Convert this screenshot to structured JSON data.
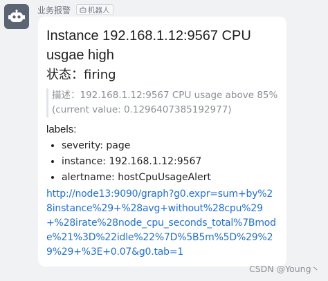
{
  "sender": {
    "name": "业务报警",
    "tag_icon": "robot-icon",
    "tag_label": "机器人",
    "avatar_icon": "robot-avatar-icon",
    "avatar_color": "#5a6472"
  },
  "message": {
    "title": "Instance 192.168.1.12:9567 CPU usgae high",
    "status_label": "状态：",
    "status_value": "firing",
    "description": "描述：192.168.1.12:9567 CPU usage above 85% (current value: 0.1296407385192977)",
    "labels_heading": "labels:",
    "labels": [
      "severity: page",
      "instance: 192.168.1.12:9567",
      "alertname: hostCpuUsageAlert"
    ],
    "link": "http://node13:9090/graph?g0.expr=sum+by%28instance%29+%28avg+without%28cpu%29+%28irate%28node_cpu_seconds_total%7Bmode%21%3D%22idle%22%7D%5B5m%5D%29%29%29+%3E+0.07&g0.tab=1",
    "link_color": "#1f6fd8"
  },
  "watermark": "CSDN @Young丶"
}
